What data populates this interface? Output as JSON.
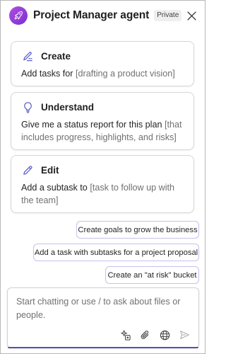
{
  "header": {
    "title": "Project Manager agent",
    "badge": "Private",
    "agent_icon": "rocket-icon",
    "close_icon": "close-icon"
  },
  "cards": [
    {
      "icon": "pen-lines-icon",
      "title": "Create",
      "text": "Add tasks for ",
      "placeholder": "[drafting a product vision]"
    },
    {
      "icon": "lightbulb-icon",
      "title": "Understand",
      "text": "Give me a status report for this plan ",
      "placeholder": "[that includes progress, highlights, and risks]"
    },
    {
      "icon": "pencil-icon",
      "title": "Edit",
      "text": "Add a subtask to ",
      "placeholder": "[task to follow up with the team]"
    }
  ],
  "suggestions": [
    "Create goals to grow the business",
    "Add a task with subtasks for a project proposal",
    "Create an \"at risk\" bucket"
  ],
  "composer": {
    "placeholder": "Start chatting or use / to ask about files or people.",
    "tools": [
      "sparkle-add-icon",
      "attach-icon",
      "globe-icon",
      "send-icon"
    ]
  },
  "colors": {
    "accent": "#4f52b2",
    "avatar": "#9b3fdb",
    "chip_border": "#c7c0ec"
  }
}
